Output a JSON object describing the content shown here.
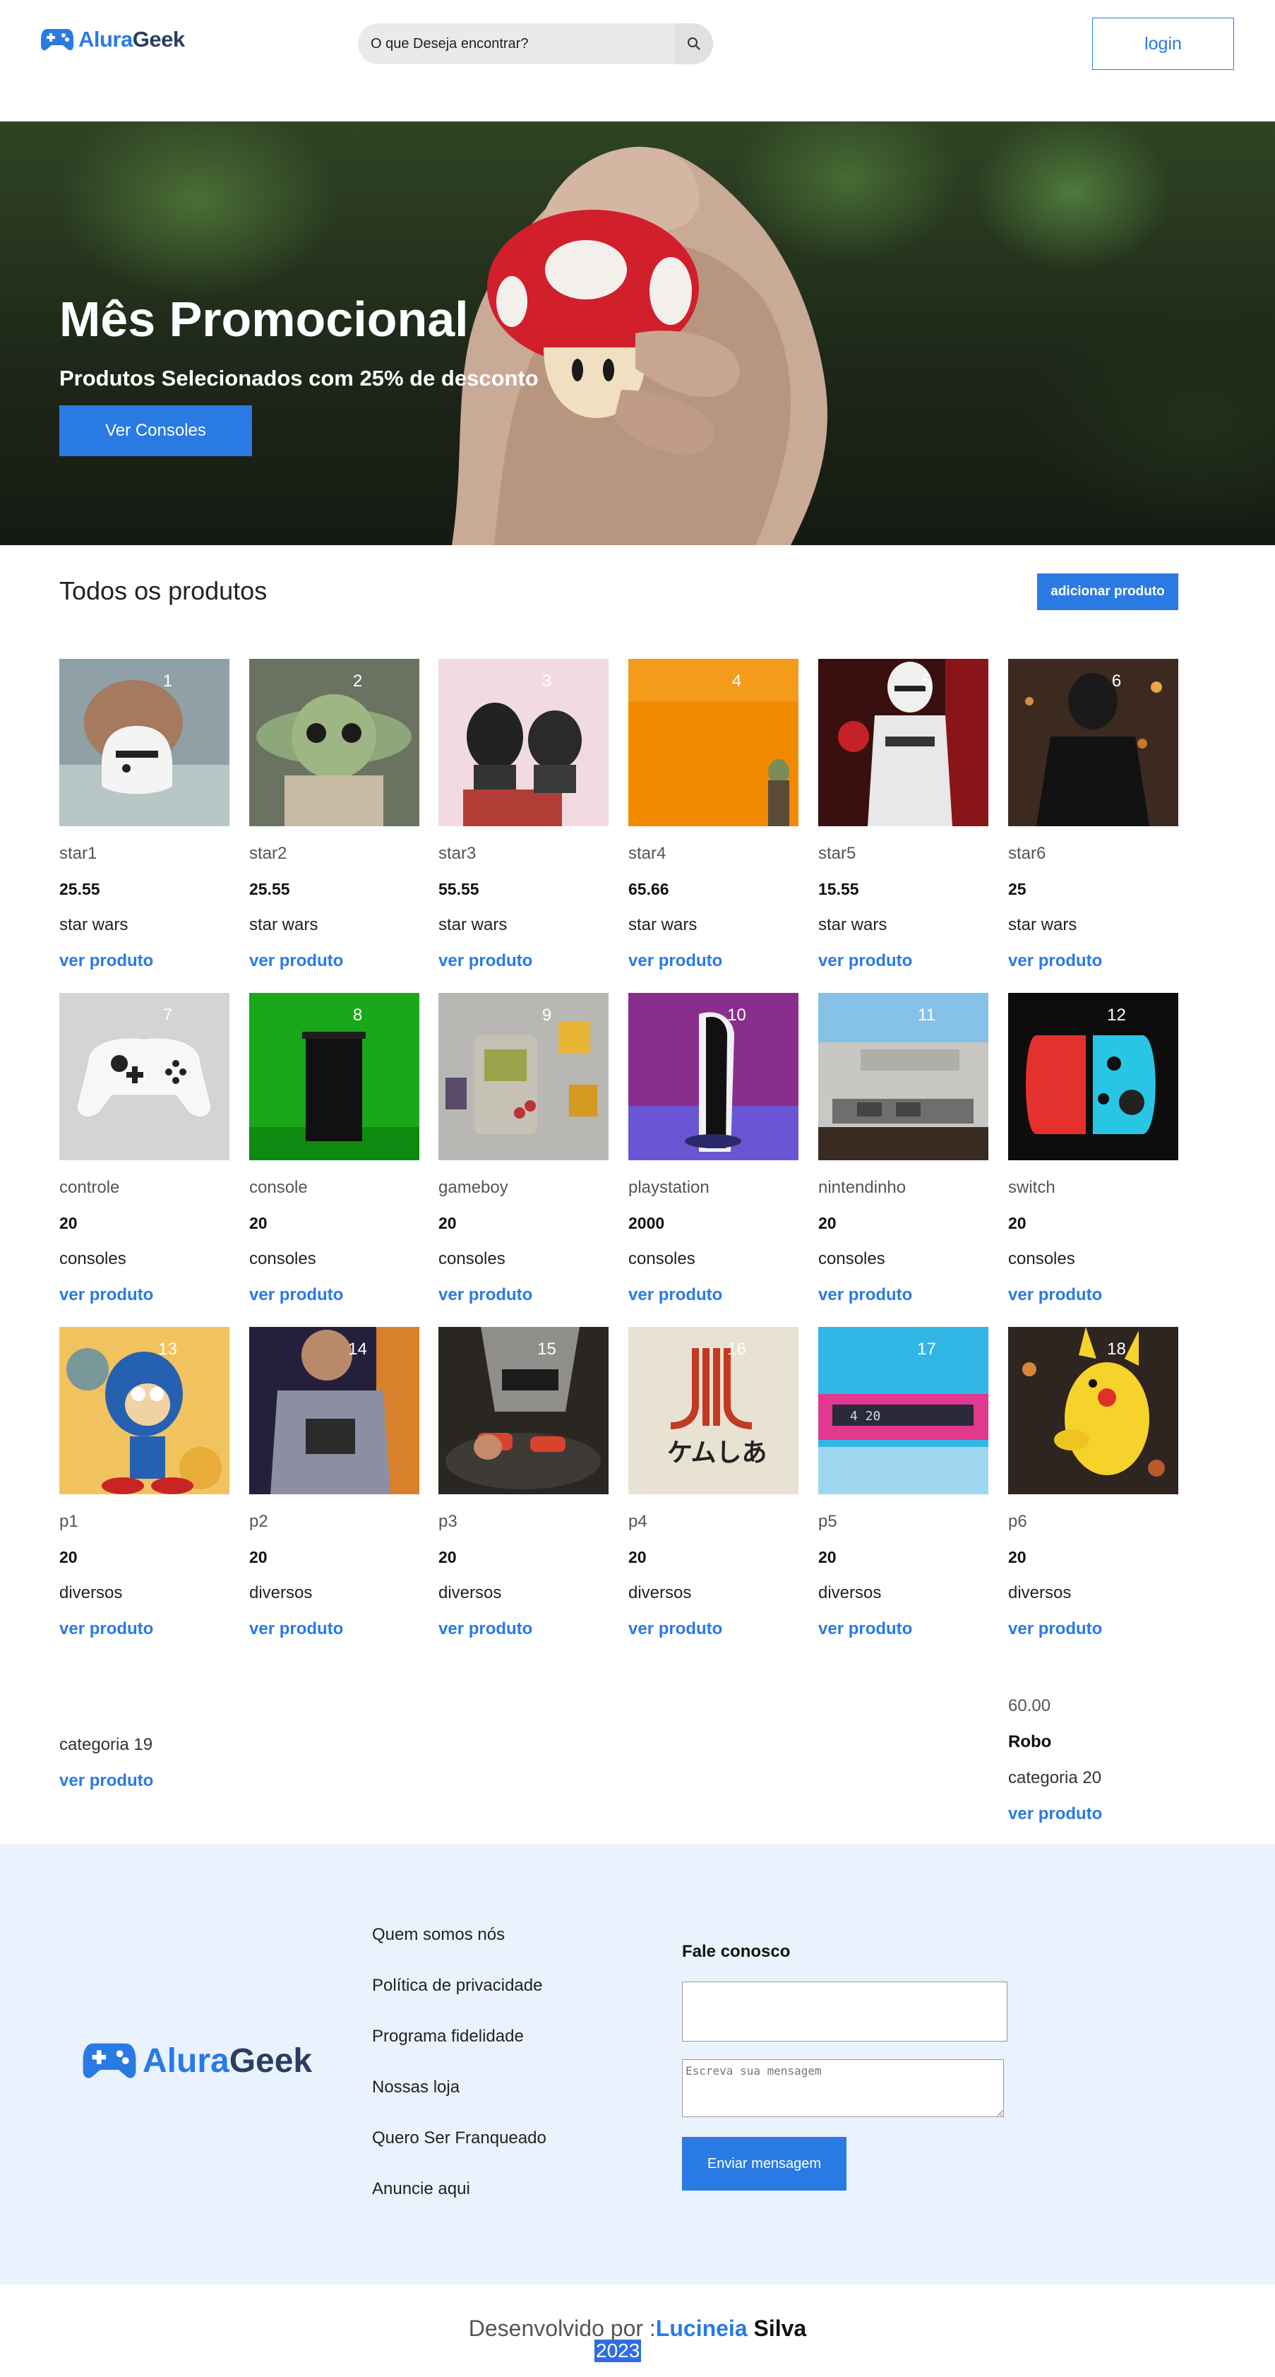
{
  "header": {
    "logo_part1": "Alura",
    "logo_part2": "Geek",
    "search_placeholder": "O que Deseja encontrar?",
    "login_label": "login"
  },
  "hero": {
    "title": "Mês Promocional",
    "subtitle": "Produtos Selecionados com 25% de desconto",
    "button_label": "Ver Consoles"
  },
  "products": {
    "title": "Todos os produtos",
    "add_label": "adicionar produto",
    "items": [
      {
        "num": "1",
        "name": "star1",
        "price": "25.55",
        "category": "star wars",
        "link": "ver produto",
        "icon": "stormtrooper-helmet"
      },
      {
        "num": "2",
        "name": "star2",
        "price": "25.55",
        "category": "star wars",
        "link": "ver produto",
        "icon": "baby-yoda"
      },
      {
        "num": "3",
        "name": "star3",
        "price": "55.55",
        "category": "star wars",
        "link": "ver produto",
        "icon": "lego-helmets"
      },
      {
        "num": "4",
        "name": "star4",
        "price": "65.66",
        "category": "star wars",
        "link": "ver produto",
        "icon": "yoda-figure"
      },
      {
        "num": "5",
        "name": "star5",
        "price": "15.55",
        "category": "star wars",
        "link": "ver produto",
        "icon": "stormtrooper"
      },
      {
        "num": "6",
        "name": "star6",
        "price": "25",
        "category": "star wars",
        "link": "ver produto",
        "icon": "kylo-ren"
      },
      {
        "num": "7",
        "name": "controle",
        "price": "20",
        "category": "consoles",
        "link": "ver produto",
        "icon": "xbox-controller"
      },
      {
        "num": "8",
        "name": "console",
        "price": "20",
        "category": "consoles",
        "link": "ver produto",
        "icon": "xbox-series-x"
      },
      {
        "num": "9",
        "name": "gameboy",
        "price": "20",
        "category": "consoles",
        "link": "ver produto",
        "icon": "gameboy"
      },
      {
        "num": "10",
        "name": "playstation",
        "price": "2000",
        "category": "consoles",
        "link": "ver produto",
        "icon": "ps5"
      },
      {
        "num": "11",
        "name": "nintendinho",
        "price": "20",
        "category": "consoles",
        "link": "ver produto",
        "icon": "nes"
      },
      {
        "num": "12",
        "name": "switch",
        "price": "20",
        "category": "consoles",
        "link": "ver produto",
        "icon": "joycon"
      },
      {
        "num": "13",
        "name": "p1",
        "price": "20",
        "category": "diversos",
        "link": "ver produto",
        "icon": "sonic"
      },
      {
        "num": "14",
        "name": "p2",
        "price": "20",
        "category": "diversos",
        "link": "ver produto",
        "icon": "kid-shirt"
      },
      {
        "num": "15",
        "name": "p3",
        "price": "20",
        "category": "diversos",
        "link": "ver produto",
        "icon": "kid-controller"
      },
      {
        "num": "16",
        "name": "p4",
        "price": "20",
        "category": "diversos",
        "link": "ver produto",
        "icon": "atari-shirt"
      },
      {
        "num": "17",
        "name": "p5",
        "price": "20",
        "category": "diversos",
        "link": "ver produto",
        "icon": "pink-clock"
      },
      {
        "num": "18",
        "name": "p6",
        "price": "20",
        "category": "diversos",
        "link": "ver produto",
        "icon": "pikachu"
      }
    ],
    "extra_left": {
      "category": "categoria 19",
      "link": "ver produto"
    },
    "extra_right": {
      "price": "60.00",
      "name": "Robo",
      "category": "categoria 20",
      "link": "ver produto"
    }
  },
  "footer": {
    "logo_part1": "Alura",
    "logo_part2": "Geek",
    "links": [
      "Quem somos nós",
      "Política de privacidade",
      "Programa fidelidade",
      "Nossas loja",
      "Quero Ser Franqueado",
      "Anuncie aqui"
    ],
    "contact_title": "Fale conosco",
    "message_placeholder": "Escreva sua mensagem",
    "send_label": "Enviar mensagem"
  },
  "credits": {
    "prefix": "Desenvolvido por :",
    "author_first": "Lucineia",
    "author_last": "Silva",
    "year": "2023"
  },
  "colors": {
    "accent": "#2A7AE4",
    "footer_bg": "#EAF2FD"
  }
}
